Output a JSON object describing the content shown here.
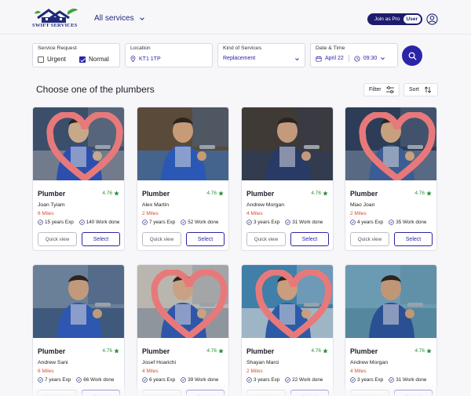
{
  "header": {
    "logo_text": "SWIFT SERVICES",
    "nav_services": "All services",
    "role_pro": "Join as Pro",
    "role_user": "User"
  },
  "filters": {
    "request_label": "Service Request",
    "urgent_label": "Urgent",
    "urgent_checked": false,
    "normal_label": "Normal",
    "normal_checked": true,
    "location_label": "Location",
    "location_value": "KT1 1TP",
    "kind_label": "Kind of Services",
    "kind_value": "Replacement",
    "date_label": "Date & Time",
    "date_value": "April 22",
    "time_value": "09:30"
  },
  "section": {
    "title": "Choose one of the plumbers",
    "filter_label": "Filter",
    "sort_label": "Sort"
  },
  "colors": {
    "accent": "#2a25a8",
    "brand_dark": "#1e1b6e",
    "rating": "#2f8f3e",
    "distance": "#d1503c"
  },
  "cards": [
    {
      "title": "Plumber",
      "rating": "4.76",
      "name": "Joan Tyiam",
      "distance": "6 Miles",
      "exp": "15 years Exp",
      "work": "140 Work done",
      "quick": "Quick view",
      "select": "Select"
    },
    {
      "title": "Plumber",
      "rating": "4.76",
      "name": "Alex Martin",
      "distance": "2 Miles",
      "exp": "7 years Exp",
      "work": "52 Work done",
      "quick": "Quick view",
      "select": "Select"
    },
    {
      "title": "Plumber",
      "rating": "4.76",
      "name": "Andrew Morgan",
      "distance": "4 Miles",
      "exp": "3 years Exp",
      "work": "31 Work done",
      "quick": "Quick view",
      "select": "Select"
    },
    {
      "title": "Plumber",
      "rating": "4.76",
      "name": "Miao Joan",
      "distance": "2 Miles",
      "exp": "4 years Exp",
      "work": "35 Work done",
      "quick": "Quick view",
      "select": "Select"
    },
    {
      "title": "Plumber",
      "rating": "4.76",
      "name": "Andrew Sani",
      "distance": "6 Miles",
      "exp": "7 years Exp",
      "work": "66 Work done",
      "quick": "Quick view",
      "select": "Select"
    },
    {
      "title": "Plumber",
      "rating": "4.76",
      "name": "Josef Hoarichi",
      "distance": "4 Miles",
      "exp": "6 years Exp",
      "work": "39 Work done",
      "quick": "Quick view",
      "select": "Select"
    },
    {
      "title": "Plumber",
      "rating": "4.76",
      "name": "Shayan Marci",
      "distance": "2 Miles",
      "exp": "3 years Exp",
      "work": "22 Work done",
      "quick": "Quick view",
      "select": "Select"
    },
    {
      "title": "Plumber",
      "rating": "4.76",
      "name": "Andrew Morgan",
      "distance": "4 Miles",
      "exp": "3 years Exp",
      "work": "31 Work done",
      "quick": "Quick view",
      "select": "Select"
    }
  ]
}
